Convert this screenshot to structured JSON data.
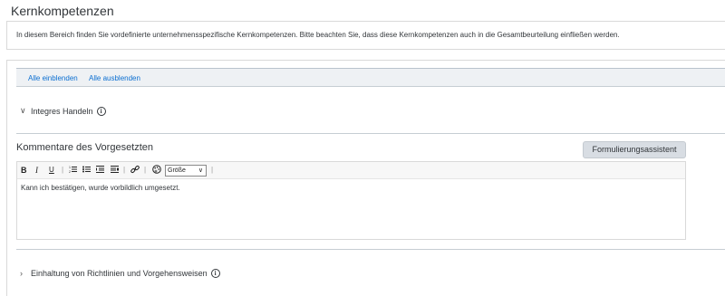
{
  "page": {
    "title": "Kernkompetenzen",
    "info_text": "In diesem Bereich finden Sie vordefinierte unternehmensspezifische Kernkompetenzen. Bitte beachten Sie, dass diese Kernkompetenzen auch in die Gesamtbeurteilung einfließen werden."
  },
  "toggle_bar": {
    "expand_all": "Alle einblenden",
    "collapse_all": "Alle ausblenden"
  },
  "sections": [
    {
      "title": "Integres Handeln",
      "expanded": true,
      "chevron": "chevron-down-icon"
    },
    {
      "title": "Einhaltung von Richtlinien und Vorgehensweisen",
      "expanded": false,
      "chevron": "chevron-right-icon"
    }
  ],
  "comments": {
    "title": "Kommentare des Vorgesetzten",
    "assistant_button": "Formulierungsassistent",
    "text": "Kann ich bestätigen, wurde vorbildlich umgesetzt."
  },
  "toolbar": {
    "bold": "B",
    "italic": "I",
    "underline": "U",
    "font_size_label": "Größe",
    "icons": [
      "bold-icon",
      "italic-icon",
      "underline-icon",
      "numbered-list-icon",
      "bulleted-list-icon",
      "outdent-icon",
      "indent-icon",
      "link-icon",
      "palette-icon"
    ]
  },
  "colors": {
    "link": "#0a6ed1",
    "toggle_bar_bg": "#eef1f4",
    "button_bg": "#d8dde3",
    "text": "#32363a"
  }
}
